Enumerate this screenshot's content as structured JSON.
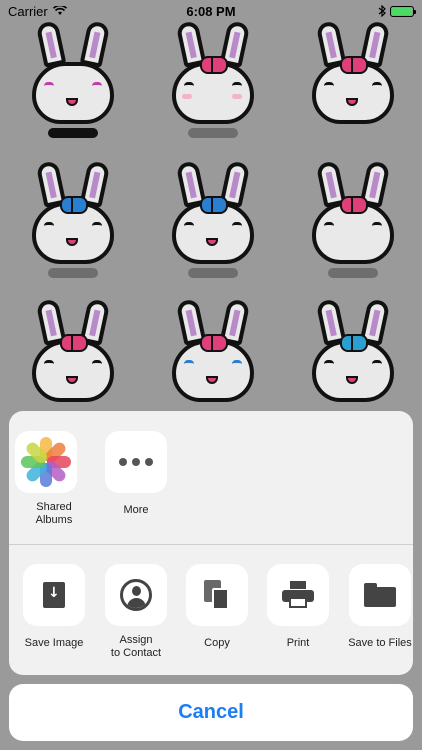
{
  "status_bar": {
    "carrier": "Carrier",
    "time": "6:08 PM",
    "battery_level": 1.0
  },
  "share_sheet": {
    "apps": [
      {
        "label": "Shared\nAlbums",
        "icon": "photos-icon"
      },
      {
        "label": "More",
        "icon": "more-icon"
      }
    ],
    "actions": [
      {
        "label": "Save Image",
        "icon": "save-image-icon"
      },
      {
        "label": "Assign\nto Contact",
        "icon": "contact-icon"
      },
      {
        "label": "Copy",
        "icon": "copy-icon"
      },
      {
        "label": "Print",
        "icon": "print-icon"
      },
      {
        "label": "Save to Files",
        "icon": "folder-icon"
      }
    ],
    "cancel_label": "Cancel"
  },
  "colors": {
    "accent": "#1a7ef5",
    "background": "#9a9a9a",
    "sheet": "#f5f5f5"
  }
}
